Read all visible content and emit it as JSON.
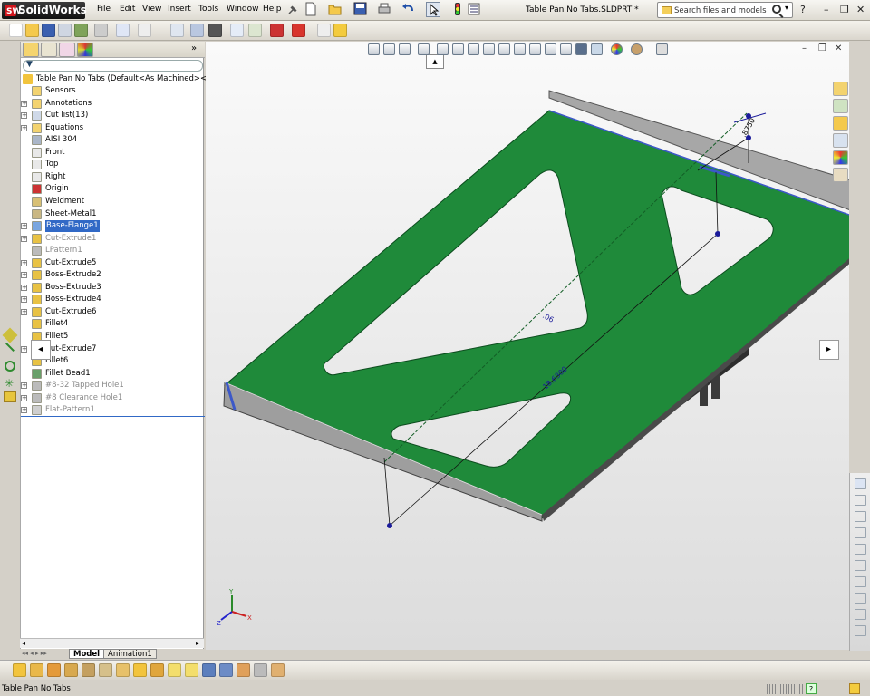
{
  "app": {
    "logo_text": "SolidWorks",
    "logo_mark": "SW",
    "title": "Table Pan No Tabs.SLDPRT *"
  },
  "menu": [
    "File",
    "Edit",
    "View",
    "Insert",
    "Tools",
    "Window",
    "Help"
  ],
  "search": {
    "placeholder": "Search files and models"
  },
  "window_controls": {
    "help": "?",
    "minimize": "–",
    "restore": "❐",
    "close": "✕"
  },
  "tree": {
    "root": "Table Pan No Tabs  (Default<As Machined><<Defa",
    "items": [
      {
        "label": "Sensors",
        "icon": "sensors-icon",
        "expand": false,
        "state": "normal"
      },
      {
        "label": "Annotations",
        "icon": "annotations-icon",
        "expand": true,
        "state": "normal"
      },
      {
        "label": "Cut list(13)",
        "icon": "cut-list-icon",
        "expand": true,
        "state": "normal"
      },
      {
        "label": "Equations",
        "icon": "equations-icon",
        "expand": true,
        "state": "normal"
      },
      {
        "label": "AISI 304",
        "icon": "material-icon",
        "expand": false,
        "state": "normal"
      },
      {
        "label": "Front",
        "icon": "plane-icon",
        "expand": false,
        "state": "normal"
      },
      {
        "label": "Top",
        "icon": "plane-icon",
        "expand": false,
        "state": "normal"
      },
      {
        "label": "Right",
        "icon": "plane-icon",
        "expand": false,
        "state": "normal"
      },
      {
        "label": "Origin",
        "icon": "origin-icon",
        "expand": false,
        "state": "normal"
      },
      {
        "label": "Weldment",
        "icon": "weldment-icon",
        "expand": false,
        "state": "normal"
      },
      {
        "label": "Sheet-Metal1",
        "icon": "sheet-metal-icon",
        "expand": false,
        "state": "normal"
      },
      {
        "label": "Base-Flange1",
        "icon": "base-flange-icon",
        "expand": true,
        "state": "selected"
      },
      {
        "label": "Cut-Extrude1",
        "icon": "cut-extrude-icon",
        "expand": true,
        "state": "suppressed"
      },
      {
        "label": "LPattern1",
        "icon": "pattern-icon",
        "expand": false,
        "state": "suppressed"
      },
      {
        "label": "Cut-Extrude5",
        "icon": "cut-extrude-icon",
        "expand": true,
        "state": "normal"
      },
      {
        "label": "Boss-Extrude2",
        "icon": "boss-extrude-icon",
        "expand": true,
        "state": "normal"
      },
      {
        "label": "Boss-Extrude3",
        "icon": "boss-extrude-icon",
        "expand": true,
        "state": "normal"
      },
      {
        "label": "Boss-Extrude4",
        "icon": "boss-extrude-icon",
        "expand": true,
        "state": "normal"
      },
      {
        "label": "Cut-Extrude6",
        "icon": "cut-extrude-icon",
        "expand": true,
        "state": "normal"
      },
      {
        "label": "Fillet4",
        "icon": "fillet-icon",
        "expand": false,
        "state": "normal"
      },
      {
        "label": "Fillet5",
        "icon": "fillet-icon",
        "expand": false,
        "state": "normal"
      },
      {
        "label": "Cut-Extrude7",
        "icon": "cut-extrude-icon",
        "expand": true,
        "state": "normal"
      },
      {
        "label": "Fillet6",
        "icon": "fillet-icon",
        "expand": false,
        "state": "normal"
      },
      {
        "label": "Fillet Bead1",
        "icon": "fillet-bead-icon",
        "expand": false,
        "state": "normal"
      },
      {
        "label": "#8-32 Tapped Hole1",
        "icon": "hole-icon",
        "expand": true,
        "state": "suppressed"
      },
      {
        "label": "#8 Clearance Hole1",
        "icon": "hole-icon",
        "expand": true,
        "state": "suppressed"
      },
      {
        "label": "Flat-Pattern1",
        "icon": "flat-pattern-icon",
        "expand": true,
        "state": "suppressed"
      }
    ]
  },
  "bottom_tabs": [
    "Model",
    "Animation1"
  ],
  "dimensions": {
    "width": "18.6300",
    "depth": ".8750",
    "half": ".06"
  },
  "triad": {
    "x": "X",
    "y": "Y",
    "z": "Z"
  },
  "panel_expand": "»",
  "filter_icon": "▼",
  "status": {
    "text": "Table Pan No Tabs",
    "help": "?"
  },
  "colors": {
    "part_face": "#1e8c3c",
    "part_edge": "#0c5a22",
    "flange": "#9c9c9c",
    "selection": "#3169c6",
    "dimension": "#1b1b9a"
  }
}
